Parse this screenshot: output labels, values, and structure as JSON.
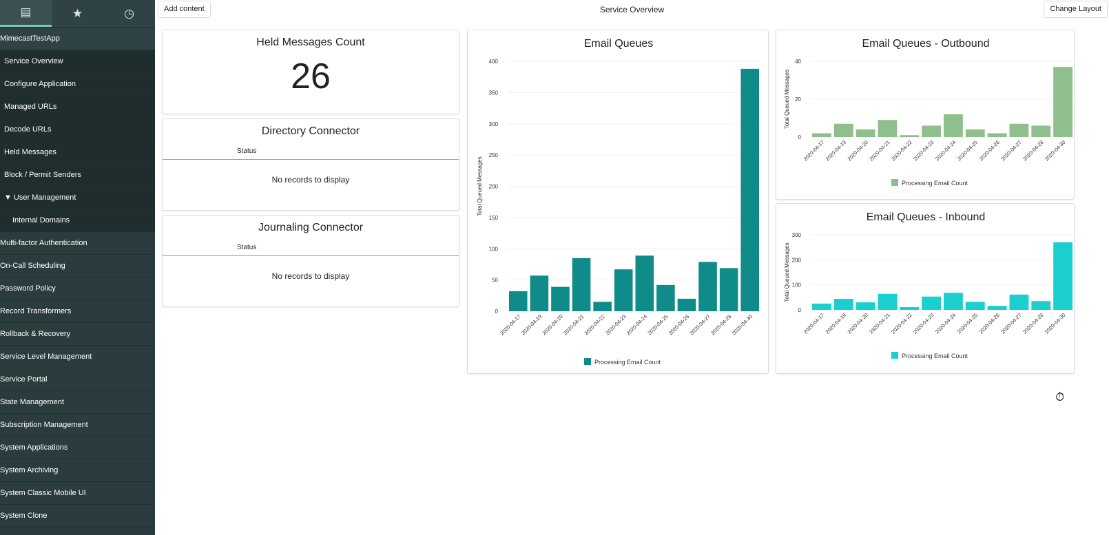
{
  "sidebar": {
    "tabs": [
      {
        "icon": "archive-icon"
      },
      {
        "icon": "star-icon"
      },
      {
        "icon": "clock-icon"
      }
    ],
    "app": "MimecastTestApp",
    "modules": [
      "Service Overview",
      "Configure Application",
      "Managed URLs",
      "Decode URLs",
      "Held Messages",
      "Block / Permit Senders"
    ],
    "group": "▼ User Management",
    "group_items": [
      "Internal Domains"
    ],
    "apps": [
      "Multi-factor Authentication",
      "On-Call Scheduling",
      "Password Policy",
      "Record Transformers",
      "Rollback & Recovery",
      "Service Level Management",
      "Service Portal",
      "State Management",
      "Subscription Management",
      "System Applications",
      "System Archiving",
      "System Classic Mobile UI",
      "System Clone"
    ]
  },
  "topbar": {
    "add_content": "Add content",
    "title": "Service Overview",
    "change_layout": "Change Layout"
  },
  "held": {
    "title": "Held Messages Count",
    "count": "26"
  },
  "directory": {
    "title": "Directory Connector",
    "column": "Status",
    "empty": "No records to display"
  },
  "journaling": {
    "title": "Journaling Connector",
    "column": "Status",
    "empty": "No records to display"
  },
  "colors": {
    "queues": "#0f8c89",
    "outbound": "#8fbf8c",
    "inbound": "#1ccfcf"
  },
  "chart_data": [
    {
      "type": "bar",
      "title": "Email Queues",
      "ylabel": "Total Queued Messages",
      "ylim": [
        0,
        400
      ],
      "yticks": [
        0,
        50,
        100,
        150,
        200,
        250,
        300,
        350,
        400
      ],
      "grid": true,
      "legend": "bottom",
      "categories": [
        "2020-04-17",
        "2020-04-19",
        "2020-04-20",
        "2020-04-21",
        "2020-04-22",
        "2020-04-23",
        "2020-04-24",
        "2020-04-25",
        "2020-04-26",
        "2020-04-27",
        "2020-04-28",
        "2020-04-30"
      ],
      "series": [
        {
          "name": "Processing Email Count",
          "values": [
            32,
            57,
            39,
            85,
            15,
            67,
            89,
            42,
            20,
            79,
            69,
            388
          ]
        }
      ]
    },
    {
      "type": "bar",
      "title": "Email Queues - Outbound",
      "ylabel": "Total Queued Messages",
      "ylim": [
        0,
        40
      ],
      "yticks": [
        0,
        20,
        40
      ],
      "grid": true,
      "legend": "bottom",
      "categories": [
        "2020-04-17",
        "2020-04-19",
        "2020-04-20",
        "2020-04-21",
        "2020-04-22",
        "2020-04-23",
        "2020-04-24",
        "2020-04-25",
        "2020-04-26",
        "2020-04-27",
        "2020-04-28",
        "2020-04-30"
      ],
      "series": [
        {
          "name": "Processing Email Count",
          "values": [
            2,
            7,
            4,
            9,
            1,
            6,
            12,
            4,
            2,
            7,
            6,
            37
          ]
        }
      ]
    },
    {
      "type": "bar",
      "title": "Email Queues - Inbound",
      "ylabel": "Total Queued Messages",
      "ylim": [
        0,
        300
      ],
      "yticks": [
        0,
        100,
        200,
        300
      ],
      "grid": true,
      "legend": "bottom",
      "categories": [
        "2020-04-17",
        "2020-04-19",
        "2020-04-20",
        "2020-04-21",
        "2020-04-22",
        "2020-04-23",
        "2020-04-24",
        "2020-04-25",
        "2020-04-26",
        "2020-04-27",
        "2020-04-28",
        "2020-04-30"
      ],
      "series": [
        {
          "name": "Processing Email Count",
          "values": [
            25,
            44,
            30,
            64,
            11,
            53,
            68,
            32,
            16,
            61,
            35,
            270
          ]
        }
      ]
    }
  ]
}
